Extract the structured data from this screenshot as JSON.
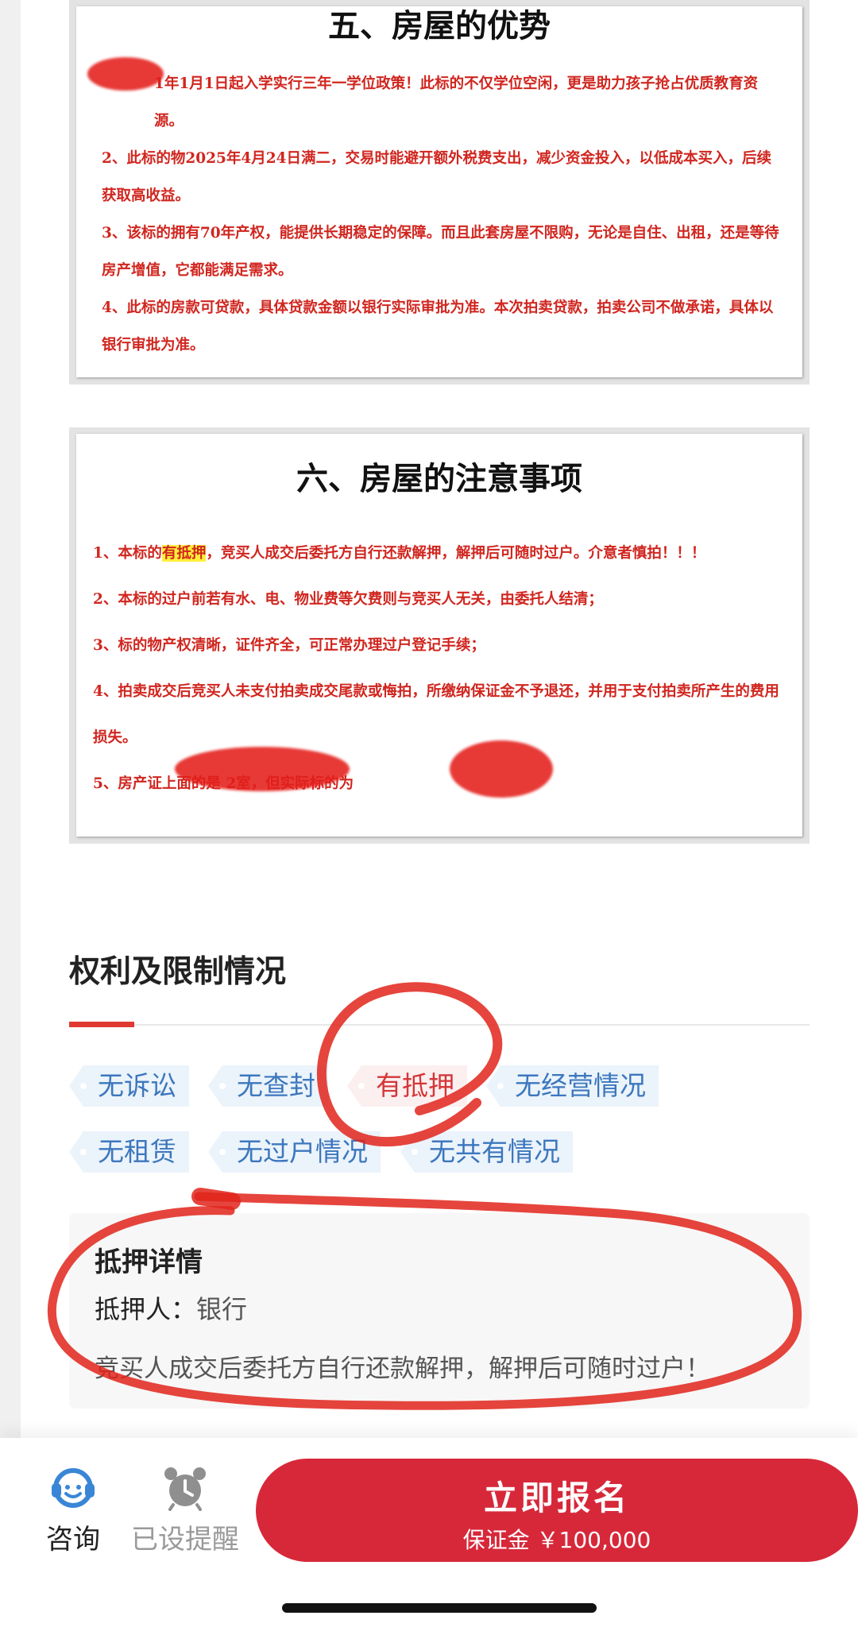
{
  "document_cards": {
    "advantages": {
      "heading": "五、房屋的优势",
      "items": [
        "1年1月1日起入学实行三年一学位政策！此标的不仅学位空闲，更是助力孩子抢占优质教育资源。",
        "2、此标的物2025年4月24日满二，交易时能避开额外税费支出，减少资金投入，以低成本买入，后续获取高收益。",
        "3、该标的拥有70年产权，能提供长期稳定的保障。而且此套房屋不限购，无论是自住、出租，还是等待房产增值，它都能满足需求。",
        "4、此标的房款可贷款，具体贷款金额以银行实际审批为准。本次拍卖贷款，拍卖公司不做承诺，具体以银行审批为准。"
      ]
    },
    "precautions": {
      "heading": "六、房屋的注意事项",
      "item1_before": "1、本标的",
      "item1_highlight": "有抵押",
      "item1_after": "，竞买人成交后委托方自行还款解押，解押后可随时过户。介意者慎拍！！！",
      "items": [
        "2、本标的过户前若有水、电、物业费等欠费则与竞买人无关，由委托人结清；",
        "3、标的物产权清晰，证件齐全，可正常办理过户登记手续；",
        "4、拍卖成交后竞买人未支付拍卖成交尾款或悔拍，所缴纳保证金不予退还，并用于支付拍卖所产生的费用损失。",
        "5、房产证上面的是          2室，但实际标的为"
      ]
    }
  },
  "rights": {
    "title": "权利及限制情况",
    "tags": [
      "无诉讼",
      "无查封",
      "有抵押",
      "无经营情况",
      "无租赁",
      "无过户情况",
      "无共有情况"
    ]
  },
  "mortgage": {
    "title": "抵押详情",
    "holder_label": "抵押人：",
    "holder_value": "银行",
    "note": "竞买人成交后委托方自行还款解押，解押后可随时过户！"
  },
  "bottom_bar": {
    "consult_label": "咨询",
    "consult_icon": "headset-icon",
    "remind_label": "已设提醒",
    "remind_icon": "alarm-clock-icon",
    "signup_label": "立即报名",
    "deposit_text": "保证金 ￥100,000"
  },
  "colors": {
    "doc_text_red": "#d0261f",
    "tag_blue": "#3c77bd",
    "tag_red": "#d53637",
    "button_red": "#d7283a",
    "annotation_red": "#e0241b"
  }
}
